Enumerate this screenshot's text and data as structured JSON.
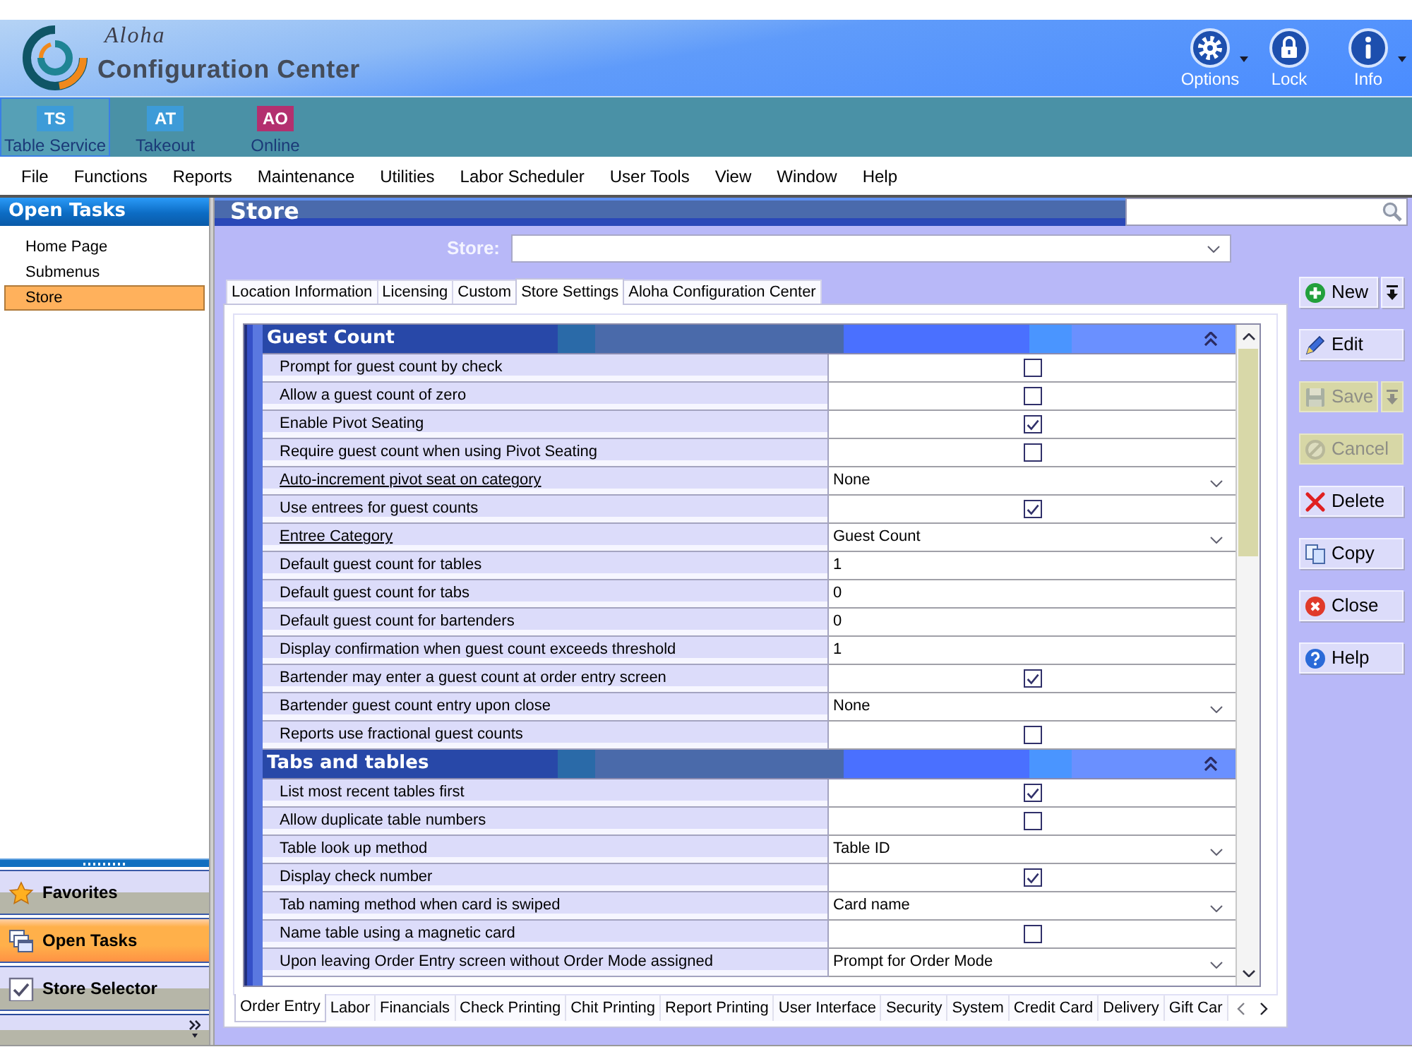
{
  "header": {
    "logo_script": "Aloha",
    "title": "Configuration Center",
    "tools": [
      {
        "label": "Options",
        "menu": true
      },
      {
        "label": "Lock",
        "menu": false
      },
      {
        "label": "Info",
        "menu": true
      }
    ]
  },
  "products": [
    {
      "code": "TS",
      "label": "Table Service",
      "selected": true,
      "color": "#3d9bd8"
    },
    {
      "code": "AT",
      "label": "Takeout",
      "selected": false,
      "color": "#3d9bd8"
    },
    {
      "code": "AO",
      "label": "Online",
      "selected": false,
      "color": "#b3306f"
    }
  ],
  "menu": [
    "File",
    "Functions",
    "Reports",
    "Maintenance",
    "Utilities",
    "Labor Scheduler",
    "User Tools",
    "View",
    "Window",
    "Help"
  ],
  "open_tasks": {
    "title": "Open Tasks",
    "items": [
      {
        "label": "Home Page",
        "selected": false
      },
      {
        "label": "Submenus",
        "selected": false
      },
      {
        "label": "Store",
        "selected": true
      }
    ]
  },
  "navigation": [
    {
      "label": "Favorites",
      "selected": false
    },
    {
      "label": "Open Tasks",
      "selected": true
    },
    {
      "label": "Store Selector",
      "selected": false
    }
  ],
  "store_panel": {
    "title": "Store",
    "store_label": "Store:",
    "tabs": [
      {
        "label": "Location Information",
        "selected": false
      },
      {
        "label": "Licensing",
        "selected": false
      },
      {
        "label": "Custom",
        "selected": false
      },
      {
        "label": "Store Settings",
        "selected": true
      },
      {
        "label": "Aloha Configuration Center",
        "selected": false
      }
    ],
    "sections": [
      {
        "title": "Guest Count",
        "expanded": true,
        "rows": [
          {
            "label": "Prompt for guest count by check",
            "link": false,
            "kind": "checkbox",
            "checked": false
          },
          {
            "label": "Allow a guest count of zero",
            "link": false,
            "kind": "checkbox",
            "checked": false
          },
          {
            "label": "Enable Pivot Seating",
            "link": false,
            "kind": "checkbox",
            "checked": true
          },
          {
            "label": "Require guest count when using Pivot Seating",
            "link": false,
            "kind": "checkbox",
            "checked": false
          },
          {
            "label": "Auto-increment pivot seat on category",
            "link": true,
            "kind": "dropdown",
            "value": "None"
          },
          {
            "label": "Use entrees for guest counts",
            "link": false,
            "kind": "checkbox",
            "checked": true
          },
          {
            "label": "Entree Category",
            "link": true,
            "kind": "dropdown",
            "value": "Guest Count"
          },
          {
            "label": "Default guest count for tables",
            "link": false,
            "kind": "text",
            "value": "1"
          },
          {
            "label": "Default guest count for tabs",
            "link": false,
            "kind": "text",
            "value": "0"
          },
          {
            "label": "Default guest count for bartenders",
            "link": false,
            "kind": "text",
            "value": "0"
          },
          {
            "label": "Display confirmation when guest count exceeds threshold",
            "link": false,
            "kind": "text",
            "value": "1"
          },
          {
            "label": "Bartender may enter a guest count at order entry screen",
            "link": false,
            "kind": "checkbox",
            "checked": true
          },
          {
            "label": "Bartender guest count entry upon close",
            "link": false,
            "kind": "dropdown",
            "value": "None"
          },
          {
            "label": "Reports use fractional guest counts",
            "link": false,
            "kind": "checkbox",
            "checked": false
          }
        ]
      },
      {
        "title": "Tabs and tables",
        "expanded": true,
        "rows": [
          {
            "label": "List most recent tables first",
            "link": false,
            "kind": "checkbox",
            "checked": true
          },
          {
            "label": "Allow duplicate table numbers",
            "link": false,
            "kind": "checkbox",
            "checked": false
          },
          {
            "label": "Table look up method",
            "link": false,
            "kind": "dropdown",
            "value": "Table ID"
          },
          {
            "label": "Display check number",
            "link": false,
            "kind": "checkbox",
            "checked": true
          },
          {
            "label": "Tab naming method when card is swiped",
            "link": false,
            "kind": "dropdown",
            "value": "Card name"
          },
          {
            "label": "Name table using a magnetic card",
            "link": false,
            "kind": "checkbox",
            "checked": false
          },
          {
            "label": "Upon leaving Order Entry screen without Order Mode assigned",
            "link": false,
            "kind": "dropdown",
            "value": "Prompt for Order Mode"
          }
        ]
      }
    ],
    "bottom_tabs": [
      {
        "label": "Order Entry",
        "selected": true
      },
      {
        "label": "Labor",
        "selected": false
      },
      {
        "label": "Financials",
        "selected": false
      },
      {
        "label": "Check Printing",
        "selected": false
      },
      {
        "label": "Chit Printing",
        "selected": false
      },
      {
        "label": "Report Printing",
        "selected": false
      },
      {
        "label": "User Interface",
        "selected": false
      },
      {
        "label": "Security",
        "selected": false
      },
      {
        "label": "System",
        "selected": false
      },
      {
        "label": "Credit Card",
        "selected": false
      },
      {
        "label": "Delivery",
        "selected": false
      },
      {
        "label": "Gift Car",
        "selected": false
      }
    ]
  },
  "actions": [
    {
      "label": "New",
      "disabled": false,
      "split": true
    },
    {
      "label": "Edit",
      "disabled": false,
      "split": false
    },
    {
      "label": "Save",
      "disabled": true,
      "split": true
    },
    {
      "label": "Cancel",
      "disabled": true,
      "split": false
    },
    {
      "label": "Delete",
      "disabled": false,
      "split": false
    },
    {
      "label": "Copy",
      "disabled": false,
      "split": false
    },
    {
      "label": "Close",
      "disabled": false,
      "split": false
    },
    {
      "label": "Help",
      "disabled": false,
      "split": false
    }
  ]
}
